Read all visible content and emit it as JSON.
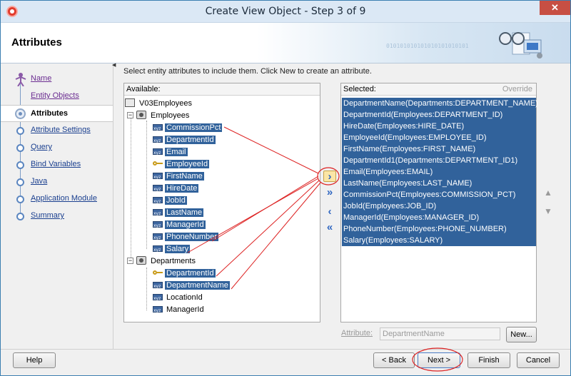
{
  "window": {
    "title": "Create View Object - Step 3 of 9",
    "close_label": "✕"
  },
  "header": {
    "title": "Attributes",
    "binary": "010101010101010101010101"
  },
  "nav": {
    "items": [
      {
        "label": "Name",
        "state": "visited"
      },
      {
        "label": "Entity Objects",
        "state": "visited"
      },
      {
        "label": "Attributes",
        "state": "active"
      },
      {
        "label": "Attribute Settings",
        "state": "todo"
      },
      {
        "label": "Query",
        "state": "todo"
      },
      {
        "label": "Bind Variables",
        "state": "todo"
      },
      {
        "label": "Java",
        "state": "todo"
      },
      {
        "label": "Application Module",
        "state": "todo"
      },
      {
        "label": "Summary",
        "state": "todo"
      }
    ]
  },
  "instruction": "Select entity attributes to include them.  Click New to create an attribute.",
  "available": {
    "label": "Available:",
    "root": "V03Employees",
    "groups": [
      {
        "name": "Employees",
        "attrs": [
          {
            "name": "CommissionPct",
            "key": false
          },
          {
            "name": "DepartmentId",
            "key": false
          },
          {
            "name": "Email",
            "key": false
          },
          {
            "name": "EmployeeId",
            "key": true
          },
          {
            "name": "FirstName",
            "key": false
          },
          {
            "name": "HireDate",
            "key": false
          },
          {
            "name": "JobId",
            "key": false
          },
          {
            "name": "LastName",
            "key": false
          },
          {
            "name": "ManagerId",
            "key": false
          },
          {
            "name": "PhoneNumber",
            "key": false
          },
          {
            "name": "Salary",
            "key": false
          }
        ]
      },
      {
        "name": "Departments",
        "attrs": [
          {
            "name": "DepartmentId",
            "key": true
          },
          {
            "name": "DepartmentName",
            "key": false
          },
          {
            "name": "LocationId",
            "key": false
          },
          {
            "name": "ManagerId",
            "key": false
          }
        ]
      }
    ]
  },
  "selected": {
    "label": "Selected:",
    "override": "Override",
    "items": [
      "DepartmentName(Departments:DEPARTMENT_NAME)",
      "DepartmentId(Employees:DEPARTMENT_ID)",
      "HireDate(Employees:HIRE_DATE)",
      "EmployeeId(Employees:EMPLOYEE_ID)",
      "FirstName(Employees:FIRST_NAME)",
      "DepartmentId1(Departments:DEPARTMENT_ID1)",
      "Email(Employees:EMAIL)",
      "LastName(Employees:LAST_NAME)",
      "CommissionPct(Employees:COMMISSION_PCT)",
      "JobId(Employees:JOB_ID)",
      "ManagerId(Employees:MANAGER_ID)",
      "PhoneNumber(Employees:PHONE_NUMBER)",
      "Salary(Employees:SALARY)"
    ]
  },
  "shuttle": {
    "add": "›",
    "add_all": "»",
    "remove": "‹",
    "remove_all": "«"
  },
  "reorder": {
    "up": "▲",
    "down": "▼"
  },
  "attribute": {
    "label": "Attribute:",
    "value": "DepartmentName",
    "new_button": "New..."
  },
  "footer": {
    "help": "Help",
    "back": "< Back",
    "next": "Next >",
    "finish": "Finish",
    "cancel": "Cancel"
  }
}
